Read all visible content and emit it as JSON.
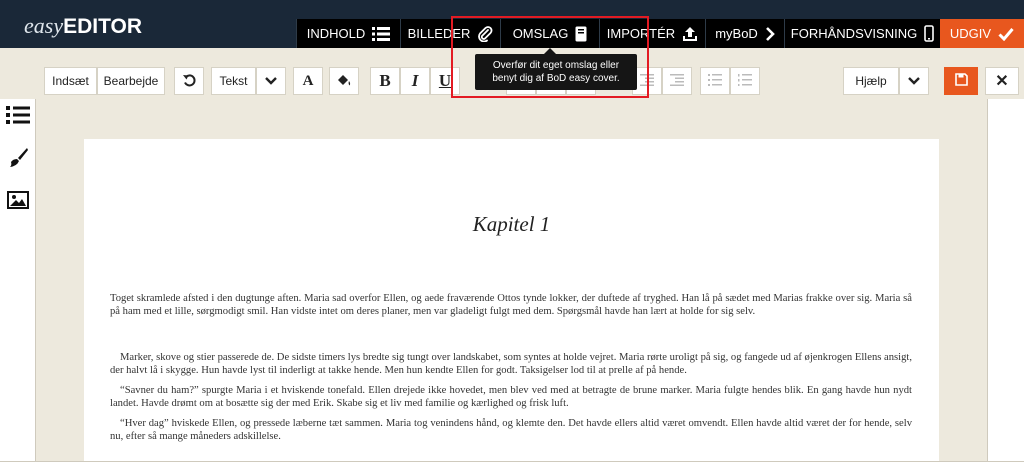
{
  "header": {
    "logo": {
      "part1": "easy",
      "part2": "EDITOR"
    },
    "nav": [
      {
        "label": "INDHOLD",
        "icon": "list-icon"
      },
      {
        "label": "BILLEDER",
        "icon": "paperclip-icon"
      },
      {
        "label": "OMSLAG",
        "icon": "book-icon"
      },
      {
        "label": "IMPORTÉR",
        "icon": "upload-icon"
      },
      {
        "label": "myBoD",
        "icon": "chevron-right-icon"
      },
      {
        "label": "FORHÅNDSVISNING",
        "icon": "phone-icon"
      }
    ],
    "publish": {
      "label": "UDGIV",
      "icon": "check-icon"
    }
  },
  "tooltip": {
    "line1": "Overfør dit eget omslag eller",
    "line2": "benyt dig af BoD easy cover."
  },
  "toolbar": {
    "insert": "Indsæt",
    "edit": "Bearbejde",
    "undo_icon": "undo-icon",
    "text_style": "Tekst",
    "font_size_icon": "A",
    "bold": "B",
    "italic": "I",
    "underline": "U",
    "help": "Hjælp",
    "save_icon": "floppy-disk-icon",
    "close": "✕"
  },
  "sidebar": {
    "items": [
      {
        "icon": "list-icon"
      },
      {
        "icon": "brush-icon"
      },
      {
        "icon": "image-icon"
      }
    ]
  },
  "document": {
    "chapter_title": "Kapitel 1",
    "paragraphs": [
      "Toget skramlede afsted i den dugtunge aften. Maria sad overfor Ellen, og aede fraværende Ottos tynde lokker, der duftede af tryghed. Han lå på sædet med Marias frakke over sig. Maria så på ham med et lille, sørgmodigt smil. Han vidste intet om deres planer, men var gladeligt fulgt med dem. Spørgsmål havde han lært at holde for sig selv.",
      "Marker, skove og stier passerede de. De sidste timers lys bredte sig tungt over landskabet, som syntes at holde vejret. Maria rørte uroligt på sig, og fangede ud af øjenkrogen Ellens ansigt, der halvt lå i skygge. Hun havde lyst til inderligt at takke hende. Men hun kendte Ellen for godt. Taksigelser lod til at prelle af på hende.",
      "“Savner du ham?” spurgte Maria i et hviskende tonefald. Ellen drejede ikke hovedet, men blev ved med at betragte de brune marker. Maria fulgte hendes blik. En gang havde hun nydt landet. Havde drømt om at bosætte sig der med Erik. Skabe sig et liv med familie og kærlighed og frisk luft.",
      "“Hver dag” hviskede Ellen, og pressede læberne tæt sammen. Maria tog venindens hånd, og klemte den. Det havde ellers altid været omvendt. Ellen havde altid været der for hende, selv nu, efter så mange måneders adskillelse."
    ]
  },
  "colors": {
    "header_bg": "#1a2838",
    "nav_bg": "#000000",
    "accent": "#e8571e",
    "workspace_bg": "#ede9dd",
    "annotation": "#e31b23"
  }
}
